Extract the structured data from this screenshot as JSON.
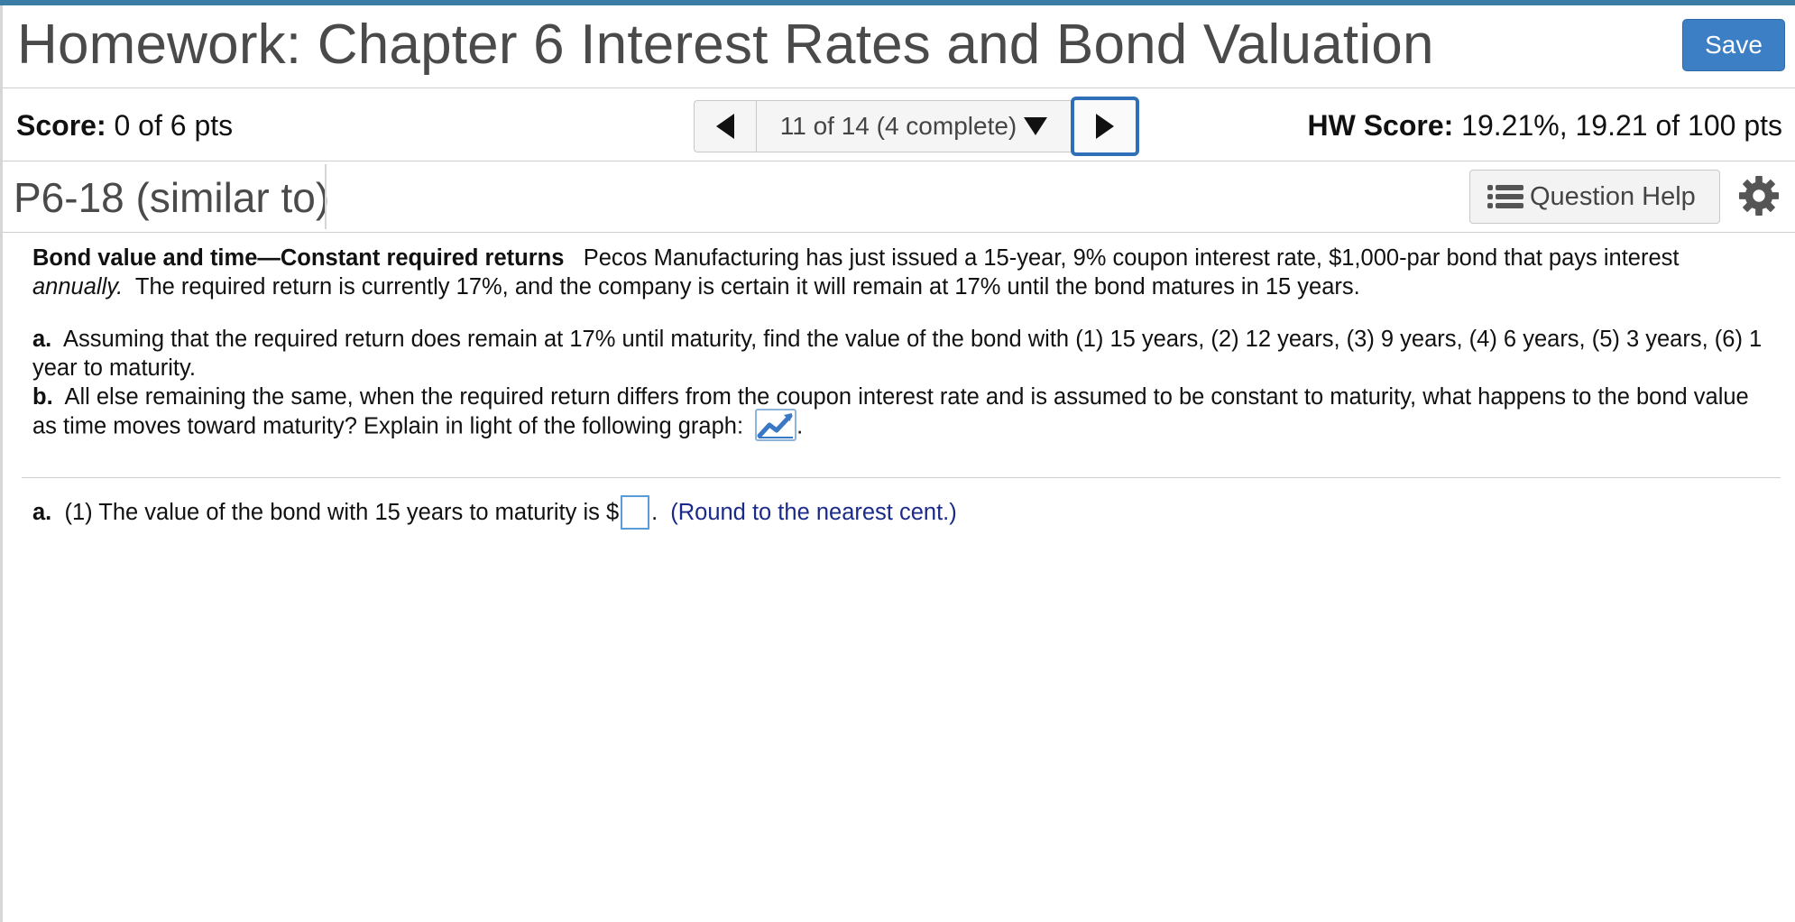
{
  "header": {
    "title": "Homework: Chapter 6 Interest Rates and Bond Valuation",
    "save_label": "Save"
  },
  "scorebar": {
    "score_label": "Score:",
    "score_value": "0 of 6 pts",
    "nav_position": "11 of 14 (4 complete)",
    "hw_score_label": "HW Score:",
    "hw_score_value": "19.21%, 19.21 of 100 pts"
  },
  "question": {
    "id": "P6-18 (similar to)",
    "help_label": "Question Help"
  },
  "problem": {
    "heading": "Bond value and time—Constant required returns",
    "intro": "Pecos Manufacturing has just issued a 15-year, 9% coupon interest rate, $1,000-par bond that pays interest",
    "intro_italic": "annually.",
    "intro_rest": "The required return is currently 17%, and the company is certain it will remain at 17% until the bond matures in 15 years.",
    "part_a_label": "a.",
    "part_a_text": "Assuming that the required return does remain at 17% until maturity, find the value of the bond with (1) 15 years, (2) 12 years, (3) 9 years, (4) 6 years, (5) 3 years, (6) 1 year to maturity.",
    "part_b_label": "b.",
    "part_b_text": "All else remaining the same, when the required return differs from the coupon interest rate and is assumed to be constant to maturity, what happens to the bond value as time moves toward maturity?  Explain in light of the following graph:",
    "part_b_end": "."
  },
  "answer": {
    "label": "a.",
    "text_before": "(1) The value of the bond with 15 years to maturity is $",
    "input_value": "",
    "text_after": ".",
    "hint": "(Round to the nearest cent.)"
  },
  "colors": {
    "accent": "#3a7ca5",
    "save_button": "#3d7fc4",
    "nav_next_border": "#2e6fb8",
    "hint_text": "#1a2a8a",
    "chart_icon": "#3b78c4"
  },
  "icons": {
    "prev": "triangle-left-icon",
    "next": "triangle-right-icon",
    "dropdown": "caret-down-icon",
    "help": "list-icon",
    "settings": "gear-icon",
    "graph": "line-chart-icon"
  }
}
